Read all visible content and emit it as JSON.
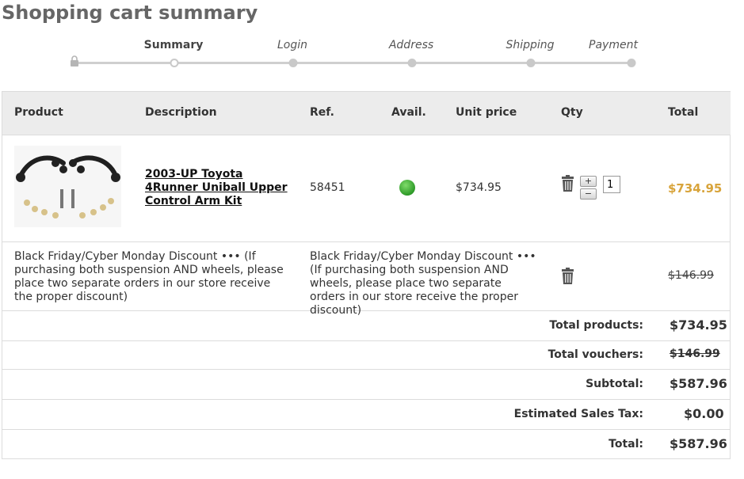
{
  "page": {
    "title": "Shopping cart summary"
  },
  "steps": [
    "Summary",
    "Login",
    "Address",
    "Shipping",
    "Payment"
  ],
  "table": {
    "headers": [
      "Product",
      "Description",
      "Ref.",
      "Avail.",
      "Unit price",
      "Qty",
      "Total"
    ]
  },
  "item": {
    "name": "2003-UP Toyota 4Runner Uniball Upper Control Arm Kit",
    "ref": "58451",
    "unit_price": "$734.95",
    "qty": "1",
    "total": "$734.95",
    "availability_color": "#3aa832"
  },
  "discount": {
    "left_text": "Black Friday/Cyber Monday Discount ••• (If purchasing both suspension AND wheels, please place two separate orders in our store receive the proper discount)",
    "mid_text": "Black Friday/Cyber Monday Discount ••• (If purchasing both suspension AND wheels, please place two separate orders in our store receive the proper discount)",
    "amount": "$146.99"
  },
  "summary": {
    "total_products_label": "Total products:",
    "total_products": "$734.95",
    "total_vouchers_label": "Total vouchers:",
    "total_vouchers": "$146.99",
    "subtotal_label": "Subtotal:",
    "subtotal": "$587.96",
    "tax_label": "Estimated Sales Tax:",
    "tax": "$0.00",
    "total_label": "Total:",
    "total": "$587.96"
  },
  "colors": {
    "title": "#666666",
    "accent_total": "#d8a43b",
    "header_bg": "#ececec",
    "step_track": "#cfcfcf"
  }
}
